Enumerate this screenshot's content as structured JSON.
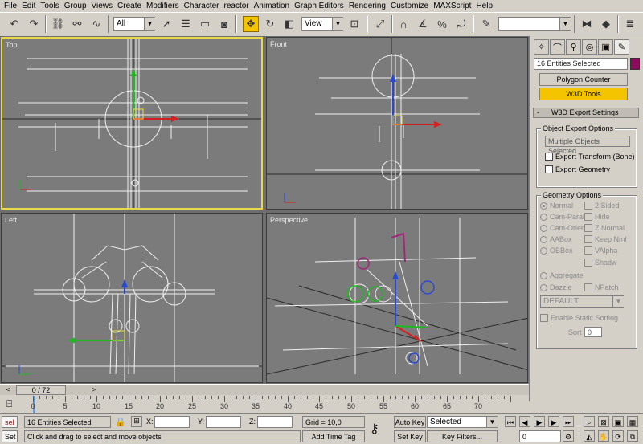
{
  "menu": [
    "File",
    "Edit",
    "Tools",
    "Group",
    "Views",
    "Create",
    "Modifiers",
    "Character",
    "reactor",
    "Animation",
    "Graph Editors",
    "Rendering",
    "Customize",
    "MAXScript",
    "Help"
  ],
  "toolbar": {
    "selection_filter": "All",
    "ref_coord": "View",
    "named_selection": "",
    "active_tool": "select-and-move-icon",
    "accent": "#f5c400"
  },
  "viewports": {
    "top": "Top",
    "front": "Front",
    "left": "Left",
    "perspective": "Perspective",
    "active": "top",
    "active_border_color": "#e9d84a"
  },
  "panel": {
    "selection_name": "16 Entities Selected",
    "selection_color": "#8b0a5a",
    "polygon_counter": "Polygon Counter",
    "w3d_tools": "W3D Tools",
    "rollout_toggle": "-",
    "rollout_title": "W3D Export Settings",
    "object_export_options": "Object Export Options",
    "multiple_objects": "Multiple Objects Selected",
    "export_transform": "Export Transform (Bone)",
    "export_geometry": "Export Geometry",
    "geometry_options": "Geometry Options",
    "radio_left": [
      "Normal",
      "Cam-Paral",
      "Cam-Orient",
      "AABox",
      "OBBox"
    ],
    "checks_right": [
      "2 Sided",
      "Hide",
      "Z Normal",
      "Keep Nml",
      "VAlpha",
      "Shadw"
    ],
    "aggregate": "Aggregate",
    "dazzle": "Dazzle",
    "npatch": "NPatch",
    "dazzle_type": "DEFAULT",
    "enable_static_sorting": "Enable Static Sorting",
    "sort_label": "Sort",
    "sort_value": "0"
  },
  "timeline": {
    "frame_display": "0 / 72",
    "ruler_labels": [
      "0",
      "5",
      "10",
      "15",
      "20",
      "25",
      "30",
      "35",
      "40",
      "45",
      "50",
      "55",
      "60",
      "65",
      "70"
    ],
    "current_frame": 0,
    "total_frames": 72
  },
  "status": {
    "script_label": "sel",
    "script_label2": "Set",
    "selection_info": "16 Entities Selected",
    "prompt": "Click and drag to select and move objects",
    "x_label": "X:",
    "y_label": "Y:",
    "z_label": "Z:",
    "x_value": "",
    "y_value": "",
    "z_value": "",
    "grid": "Grid = 10,0",
    "add_time_tag": "Add Time Tag",
    "auto_key": "Auto Key",
    "set_key": "Set Key",
    "key_mode": "Selected",
    "key_filters": "Key Filters...",
    "frame_value": "0"
  }
}
